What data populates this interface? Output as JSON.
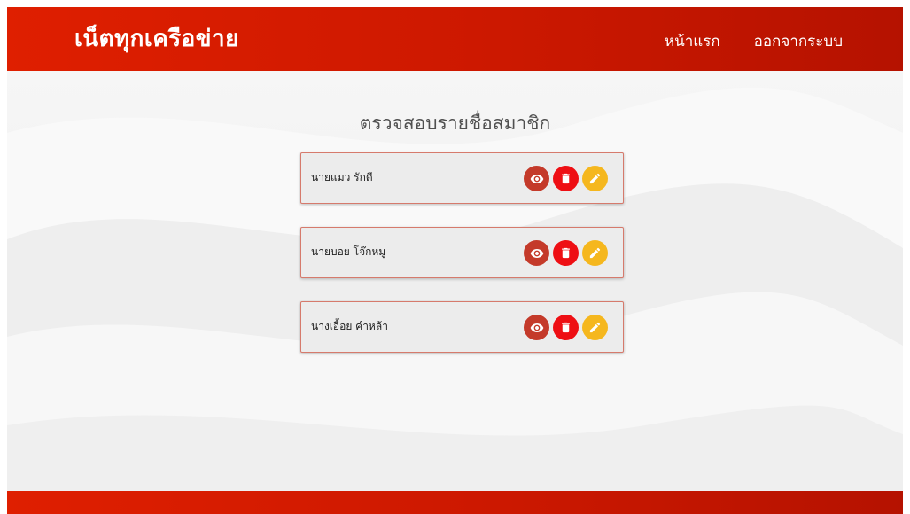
{
  "navbar": {
    "brand": "เน็ตทุกเครือข่าย",
    "links": [
      "หน้าแรก",
      "ออกจากระบบ"
    ]
  },
  "main": {
    "title": "ตรวจสอบรายชื่อสมาชิก",
    "members": [
      {
        "name": "นายแมว รักดี"
      },
      {
        "name": "นายบอย โจ๊กหมู"
      },
      {
        "name": "นางเอื้อย คำหล้า"
      }
    ]
  },
  "actions": {
    "view_icon": "eye-icon",
    "delete_icon": "trash-icon",
    "edit_icon": "pencil-icon"
  },
  "colors": {
    "brand_red": "#cc1800",
    "view_button": "#c43a2a",
    "delete_button": "#ee0f14",
    "edit_button": "#f5b71e"
  }
}
